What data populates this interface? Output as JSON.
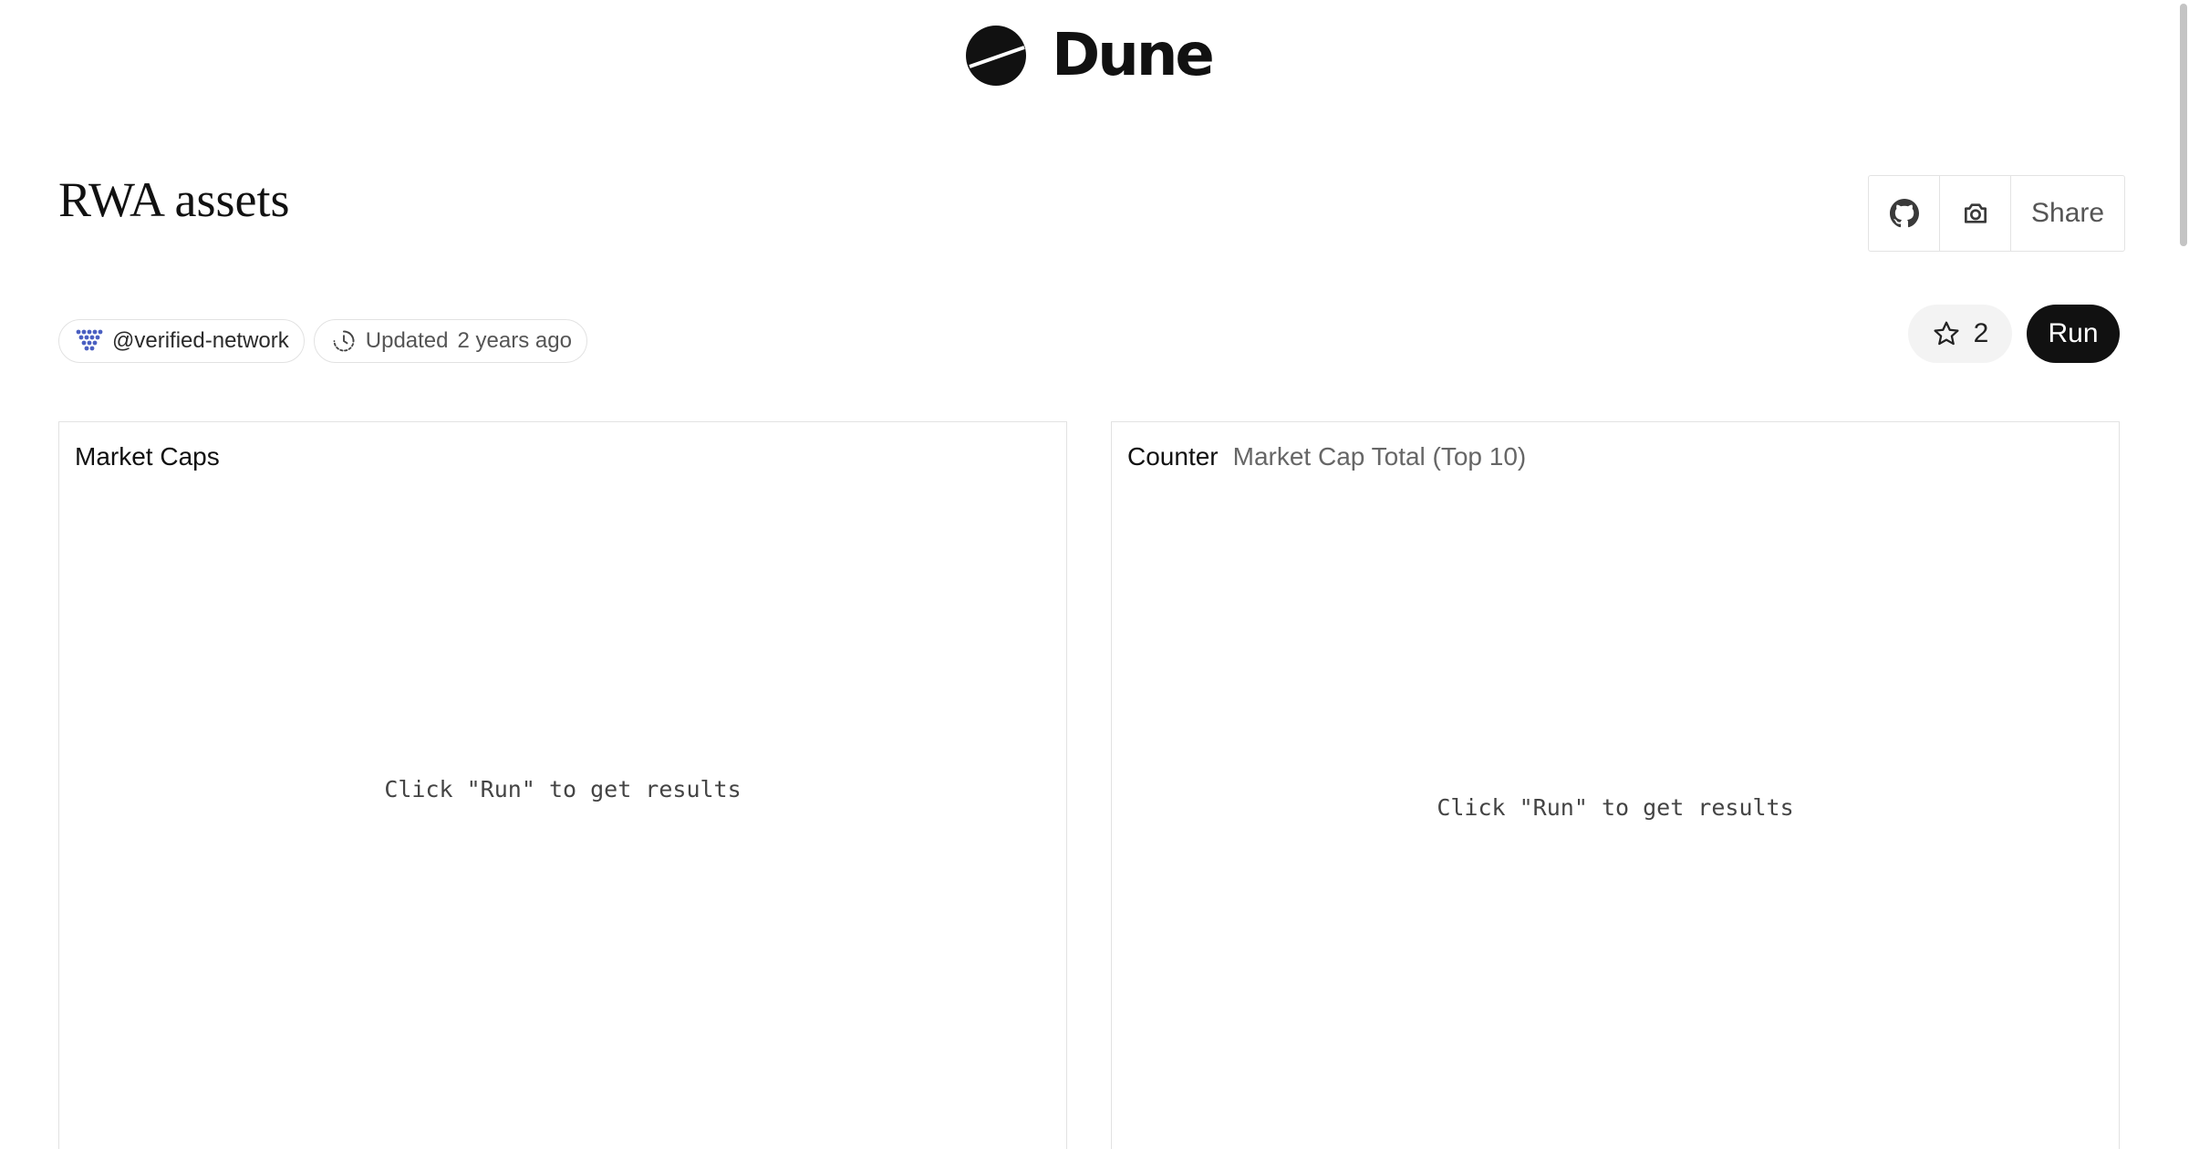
{
  "brand": {
    "name": "Dune"
  },
  "dashboard": {
    "title": "RWA assets"
  },
  "actions": {
    "share_label": "Share",
    "icons": [
      "github-icon",
      "camera-icon"
    ]
  },
  "meta": {
    "author": "@verified-network",
    "updated_label": "Updated",
    "updated_value": "2 years ago"
  },
  "stars": {
    "count": "2"
  },
  "run": {
    "label": "Run"
  },
  "panels": [
    {
      "title": "Market Caps",
      "subtitle": "",
      "placeholder": "Click \"Run\" to get results"
    },
    {
      "title": "Counter",
      "subtitle": "Market Cap Total (Top 10)",
      "placeholder": "Click \"Run\" to get results"
    }
  ],
  "colors": {
    "run_button_bg": "#111111",
    "border": "#e2e2e2",
    "author_logo": "#4a5fc1"
  }
}
